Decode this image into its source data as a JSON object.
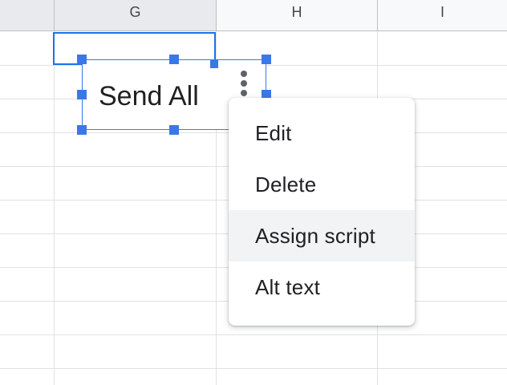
{
  "columns": [
    {
      "label": "G",
      "selected": true
    },
    {
      "label": "H",
      "selected": false
    },
    {
      "label": "I",
      "selected": false
    }
  ],
  "drawing": {
    "label": "Send All"
  },
  "context_menu": {
    "items": [
      {
        "label": "Edit",
        "highlighted": false
      },
      {
        "label": "Delete",
        "highlighted": false
      },
      {
        "label": "Assign script",
        "highlighted": true
      },
      {
        "label": "Alt text",
        "highlighted": false
      }
    ]
  },
  "colors": {
    "selection": "#1a73e8",
    "handle": "#3b78e7",
    "header_bg": "#f8f9fa",
    "selected_header_bg": "#e8eaed",
    "grid_line": "#e1e1e1",
    "menu_highlight": "#f1f3f4"
  },
  "icons": {
    "more_button": "vertical-ellipsis-icon"
  }
}
